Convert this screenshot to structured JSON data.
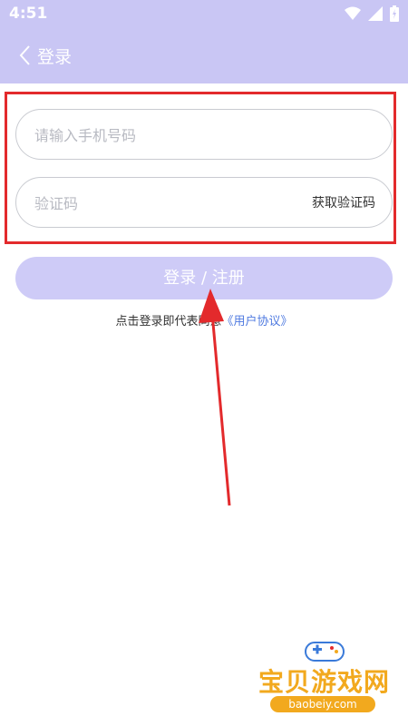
{
  "status_bar": {
    "time": "4:51"
  },
  "header": {
    "title": "登录"
  },
  "form": {
    "phone_placeholder": "请输入手机号码",
    "code_placeholder": "验证码",
    "get_code_label": "获取验证码"
  },
  "login_button_label": "登录 / 注册",
  "agreement": {
    "prefix": "点击登录即代表同意",
    "link": "《用户协议》"
  },
  "watermark": {
    "name": "宝贝游戏网",
    "url": "baobeiy.com"
  },
  "colors": {
    "header_bg": "#c9c6f4",
    "button_bg": "#cecbf7",
    "highlight": "#e32a2c",
    "link": "#4f7ae0"
  }
}
